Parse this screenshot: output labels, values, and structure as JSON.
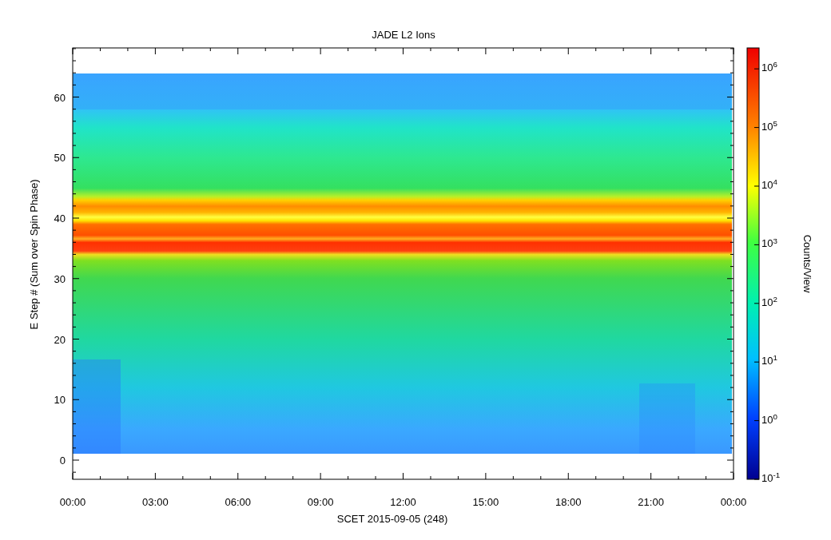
{
  "title": "JADE L2 Ions",
  "y_axis": {
    "label": "E Step # (Sum over Spin Phase)",
    "ticks": [
      "60",
      "50",
      "40",
      "30",
      "20",
      "10",
      "0"
    ]
  },
  "x_axis": {
    "label": "SCET 2015-09-05 (248)",
    "ticks": [
      "00:00",
      "03:00",
      "06:00",
      "09:00",
      "12:00",
      "15:00",
      "18:00",
      "21:00",
      "00:00"
    ]
  },
  "colorbar": {
    "label": "Counts/View",
    "ticks": [
      "10$^{6}$",
      "10$^{5}$",
      "10$^{4}$",
      "10$^{3}$",
      "10$^{2}$",
      "10$^{1}$",
      "10$^{0}$",
      "10$^{-1}$"
    ]
  }
}
